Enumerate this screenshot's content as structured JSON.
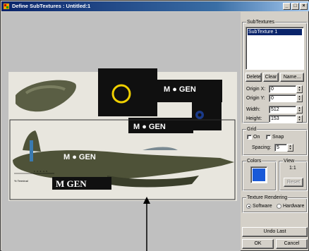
{
  "window": {
    "title": "Define SubTextures : Untitled:1",
    "min_label": "_",
    "max_label": "□",
    "close_label": "×"
  },
  "texture": {
    "code_top": "M ● GEN",
    "code_mid": "M ● GEN",
    "code_side": "M ● GEN",
    "code_bottom": "M GEN",
    "scale_label": "% Terminal",
    "scale_ticks": "1 · 2 · 3 · 4 · 5"
  },
  "subtextures": {
    "group_label": "SubTextures",
    "items": [
      "SubTexture 1"
    ],
    "selected_index": 0,
    "delete_label": "Delete",
    "clear_label": "Clear",
    "name_label": "Name...",
    "origin_x_label": "Origin X:",
    "origin_x_value": "0",
    "origin_y_label": "Origin Y:",
    "origin_y_value": "0",
    "width_label": "Width:",
    "width_value": "512",
    "height_label": "Height:",
    "height_value": "153"
  },
  "grid": {
    "group_label": "Grid",
    "on_label": "On",
    "on_checked": false,
    "snap_label": "Snap",
    "snap_checked": false,
    "spacing_label": "Spacing:",
    "spacing_value": "5"
  },
  "colors": {
    "group_label": "Colors",
    "swatch_color": "#1a5ad8"
  },
  "view": {
    "group_label": "View",
    "ratio": "1:1",
    "reset_label": "Reset"
  },
  "rendering": {
    "group_label": "Texture Rendering",
    "software_label": "Software",
    "hardware_label": "Hardware",
    "selected": "Software"
  },
  "actions": {
    "undo_label": "Undo Last",
    "ok_label": "OK",
    "cancel_label": "Cancel"
  },
  "colors_palette": {
    "titlebar_start": "#0a246a",
    "titlebar_end": "#a6caf0",
    "selection": "#0a246a",
    "canvas_bg": "#c0c0c0",
    "ring": "#f0d000"
  }
}
